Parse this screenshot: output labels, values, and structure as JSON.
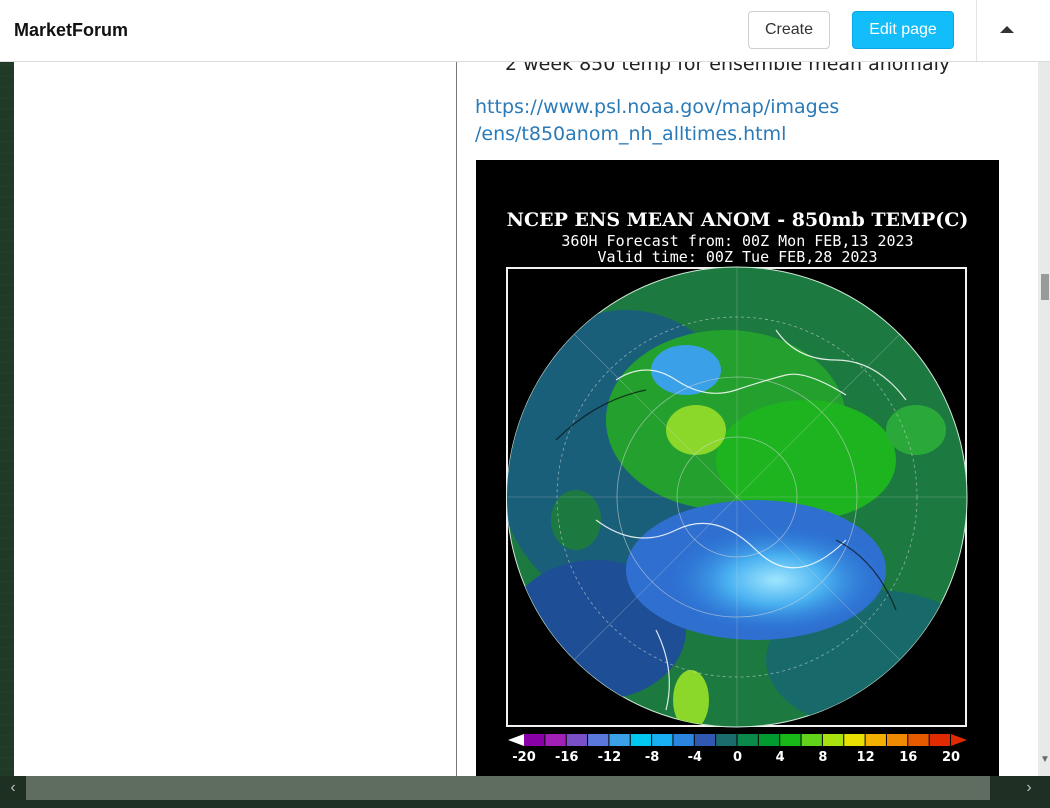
{
  "header": {
    "brand": "MarketForum",
    "create_label": "Create",
    "edit_label": "Edit page"
  },
  "post": {
    "caption": "2 week  850 temp for ensemble mean anomaly",
    "link_line1": "https://www.psl.noaa.gov/map/images",
    "link_line2": "/ens/t850anom_nh_alltimes.html",
    "link_href": "https://www.psl.noaa.gov/map/images/ens/t850anom_nh_alltimes.html"
  },
  "map": {
    "title": "NCEP ENS MEAN ANOM - 850mb TEMP(C)",
    "forecast": "360H Forecast from: 00Z Mon FEB,13 2023",
    "valid": "Valid time: 00Z Tue FEB,28 2023",
    "colorbar_labels": [
      "-20",
      "-16",
      "-12",
      "-8",
      "-4",
      "0",
      "4",
      "8",
      "12",
      "16",
      "20"
    ],
    "colorbar_colors": [
      "#8a00a8",
      "#a020b8",
      "#7a50c8",
      "#5a78dc",
      "#3aa0e8",
      "#00c8f0",
      "#18b0f0",
      "#2a86e0",
      "#3058b0",
      "#1a6c6c",
      "#0a8a4a",
      "#009a30",
      "#18b818",
      "#62d21a",
      "#a8e010",
      "#e8e000",
      "#f2b000",
      "#f08a00",
      "#e85a00",
      "#e02a00"
    ],
    "land_color": "#1f8a3a",
    "ocean_cold_color": "#1f5a8a",
    "cold_core_color": "#48b0f0"
  },
  "icons": {
    "scroll_up": "caret-up-icon",
    "scroll_left": "chevron-left-icon",
    "scroll_right": "chevron-right-icon",
    "scroll_down": "chevron-down-icon"
  }
}
